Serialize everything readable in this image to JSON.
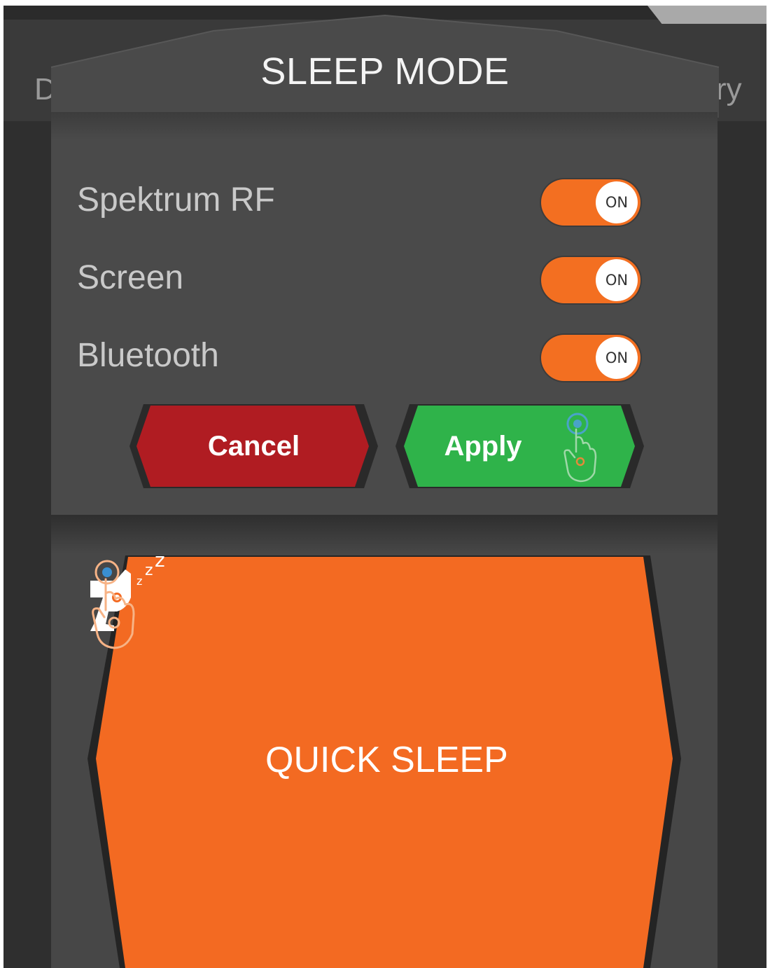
{
  "background": {
    "left_text": "D",
    "right_text": "ry"
  },
  "modal": {
    "title": "SLEEP MODE",
    "settings": [
      {
        "label": "Spektrum RF",
        "toggle_text": "ON",
        "on": true
      },
      {
        "label": "Screen",
        "toggle_text": "ON",
        "on": true
      },
      {
        "label": "Bluetooth",
        "toggle_text": "ON",
        "on": true
      }
    ],
    "cancel_label": "Cancel",
    "apply_label": "Apply",
    "apply_icon": "tap-hand-icon"
  },
  "quick_sleep": {
    "label": "QUICK SLEEP",
    "left_icon": "radio-transmitter-sleep-icon",
    "right_icon": "tap-hand-icon"
  },
  "colors": {
    "accent_orange": "#f36f21",
    "cancel_red": "#b01c22",
    "apply_green": "#2fb34a",
    "panel_gray": "#4a4a4a",
    "background_dark": "#363636"
  }
}
